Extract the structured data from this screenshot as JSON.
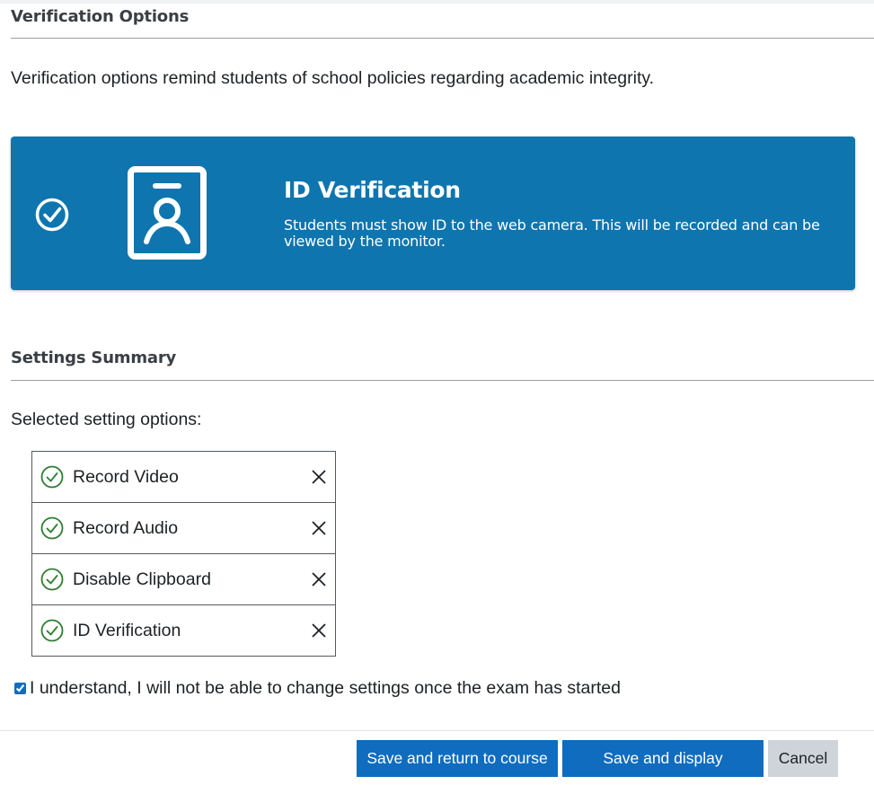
{
  "verification_section": {
    "heading": "Verification Options",
    "intro": "Verification options remind students of school policies regarding academic integrity.",
    "card": {
      "title": "ID Verification",
      "description": "Students must show ID to the web camera. This will be recorded and can be viewed by the monitor.",
      "selected": true,
      "background_color": "#0f75ae",
      "icons": [
        "check-circle-icon",
        "id-badge-icon"
      ]
    }
  },
  "settings_summary": {
    "heading": "Settings Summary",
    "selected_label": "Selected setting options:",
    "options": [
      {
        "label": "Record Video"
      },
      {
        "label": "Record Audio"
      },
      {
        "label": "Disable Clipboard"
      },
      {
        "label": "ID Verification"
      }
    ],
    "check_color": "#2e7d32"
  },
  "acknowledgement": {
    "label": "I understand, I will not be able to change settings once the exam has started",
    "checked": true
  },
  "buttons": {
    "save_return": "Save and return to course",
    "save_display": "Save and display",
    "cancel": "Cancel",
    "primary_color": "#0f6cbf",
    "secondary_color": "#ced4da"
  }
}
